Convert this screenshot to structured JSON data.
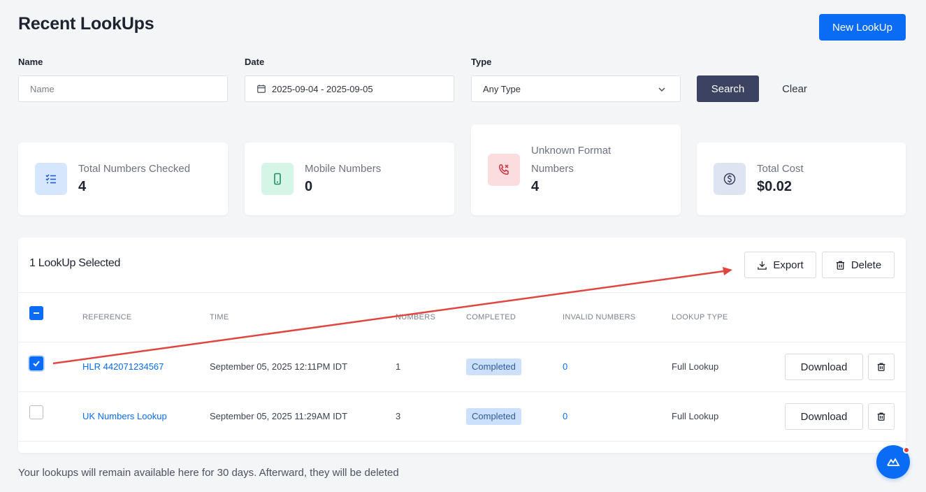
{
  "header": {
    "title": "Recent LookUps",
    "new_lookup_label": "New LookUp"
  },
  "filters": {
    "name_label": "Name",
    "name_placeholder": "Name",
    "date_label": "Date",
    "date_value": "2025-09-04 - 2025-09-05",
    "type_label": "Type",
    "type_value": "Any Type",
    "search_label": "Search",
    "clear_label": "Clear"
  },
  "stats": [
    {
      "label": "Total Numbers Checked",
      "value": "4",
      "icon": "checklist-icon",
      "icon_bg": "#d6e6fd",
      "icon_color": "#1d5fd1"
    },
    {
      "label": "Mobile Numbers",
      "value": "0",
      "icon": "mobile-phone-icon",
      "icon_bg": "#d5f5e6",
      "icon_color": "#1f8f5c"
    },
    {
      "label_line1": "Unknown Format",
      "label_line2": "Numbers",
      "value": "4",
      "icon": "phone-x-icon",
      "icon_bg": "#fbdde0",
      "icon_color": "#c8323f"
    },
    {
      "label": "Total Cost",
      "value": "$0.02",
      "icon": "dollar-circle-icon",
      "icon_bg": "#dfe4f3",
      "icon_color": "#3c4262"
    }
  ],
  "table": {
    "selected_label": "1 LookUp Selected",
    "export_label": "Export",
    "delete_label": "Delete",
    "columns": [
      "REFERENCE",
      "TIME",
      "NUMBERS",
      "COMPLETED",
      "INVALID NUMBERS",
      "LOOKUP TYPE"
    ],
    "rows": [
      {
        "selected": true,
        "reference": "HLR 442071234567",
        "time": "September 05, 2025 12:11PM IDT",
        "numbers": "1",
        "status": "Completed",
        "invalid": "0",
        "type": "Full Lookup",
        "download_label": "Download"
      },
      {
        "selected": false,
        "reference": "UK Numbers Lookup",
        "time": "September 05, 2025 11:29AM IDT",
        "numbers": "3",
        "status": "Completed",
        "invalid": "0",
        "type": "Full Lookup",
        "download_label": "Download"
      }
    ]
  },
  "footer_note": "Your lookups will remain available here for 30 days. Afterward, they will be deleted",
  "colors": {
    "primary": "#0a6cf4",
    "search_button": "#3c4262",
    "annotation_arrow": "#e0463f"
  }
}
